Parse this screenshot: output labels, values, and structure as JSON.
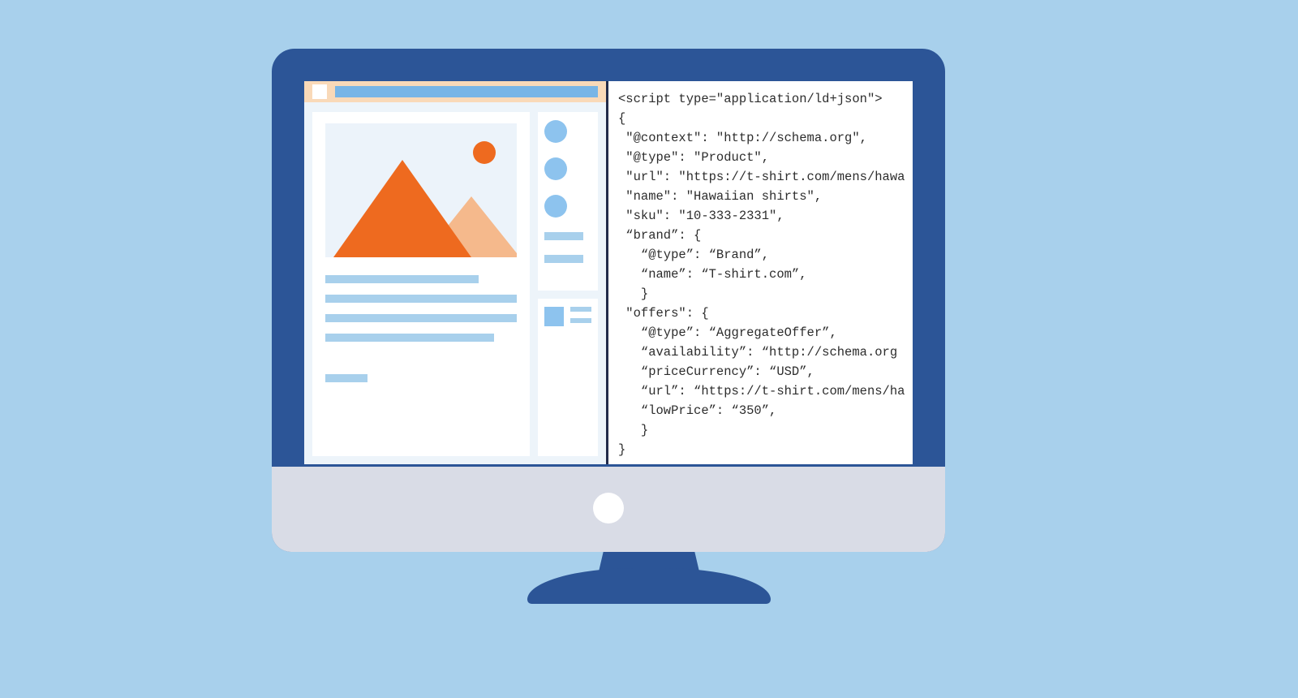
{
  "code_lines": [
    "<script type=\"application/ld+json\">",
    "{",
    " \"@context\": \"http://schema.org\",",
    " \"@type\": \"Product\",",
    " \"url\": \"https://t-shirt.com/mens/hawa",
    " \"name\": \"Hawaiian shirts\",",
    " \"sku\": \"10-333-2331\",",
    " “brand”: {",
    "   “@type”: “Brand”,",
    "   “name”: “T-shirt.com”,",
    "   }",
    " \"offers\": {",
    "   “@type”: “AggregateOffer”,",
    "   “availability”: “http://schema.org",
    "   “priceCurrency”: “USD”,",
    "   “url”: “https://t-shirt.com/mens/ha",
    "   “lowPrice”: “350”,",
    "   }",
    "}"
  ]
}
